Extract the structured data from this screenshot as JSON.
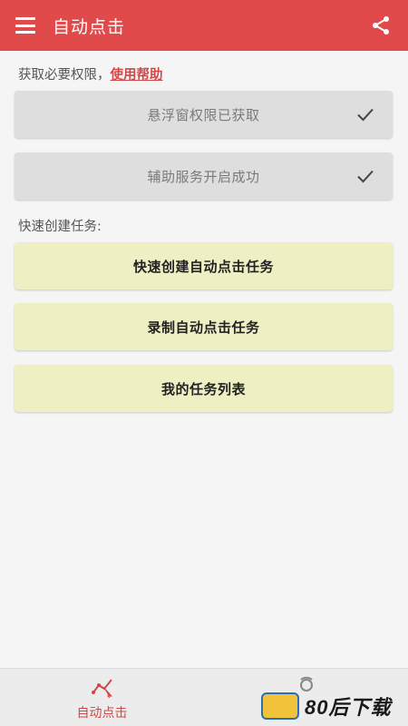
{
  "header": {
    "title": "自动点击",
    "menu_icon": "hamburger-menu-icon",
    "share_icon": "share-icon",
    "background_color": "#e04a4a"
  },
  "permissions": {
    "label_prefix": "获取必要权限，",
    "help_link": "使用帮助",
    "items": [
      {
        "label": "悬浮窗权限已获取",
        "status_icon": "check-icon"
      },
      {
        "label": "辅助服务开启成功",
        "status_icon": "check-icon"
      }
    ]
  },
  "quick_create": {
    "label": "快速创建任务:",
    "actions": [
      {
        "label": "快速创建自动点击任务"
      },
      {
        "label": "录制自动点击任务"
      },
      {
        "label": "我的任务列表"
      }
    ],
    "card_color": "#eef0c4"
  },
  "bottom_nav": {
    "items": [
      {
        "label": "自动点击",
        "icon": "auto-click-icon",
        "active": true
      },
      {
        "label": "",
        "icon": "robot-icon",
        "active": false
      }
    ],
    "active_color": "#d04848"
  },
  "watermark": {
    "text": "80后下载"
  }
}
